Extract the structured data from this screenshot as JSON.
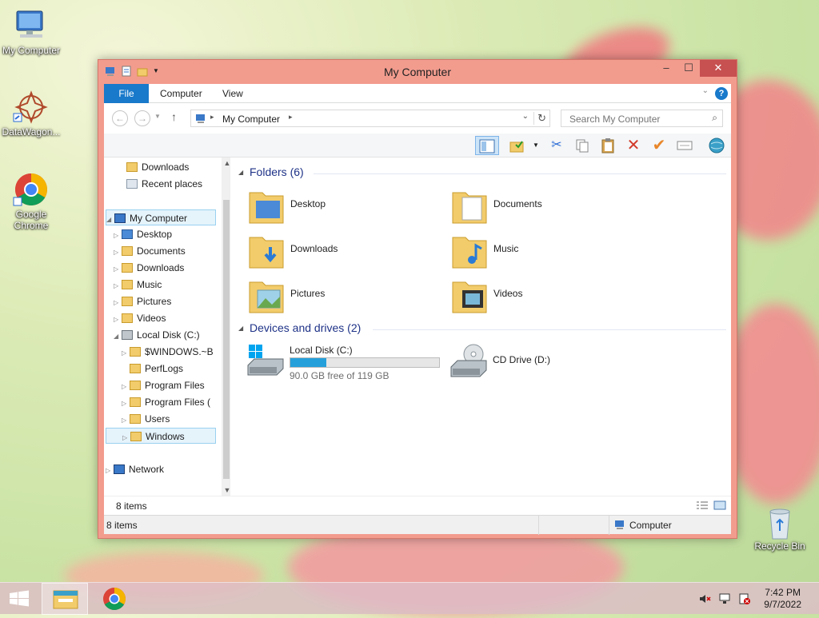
{
  "desktop": {
    "icons": [
      {
        "label": "My Computer"
      },
      {
        "label": "DataWagon..."
      },
      {
        "label": "Google Chrome"
      },
      {
        "label": "Recycle Bin"
      }
    ]
  },
  "window": {
    "title": "My Computer",
    "ribbon_tabs": [
      "File",
      "Computer",
      "View"
    ],
    "address": "My Computer",
    "search_placeholder": "Search My Computer",
    "nav_tree": {
      "top": [
        "Downloads",
        "Recent places"
      ],
      "my_computer": "My Computer",
      "children": [
        "Desktop",
        "Documents",
        "Downloads",
        "Music",
        "Pictures",
        "Videos"
      ],
      "local_disk": "Local Disk (C:)",
      "disk_children": [
        "$WINDOWS.~B",
        "PerfLogs",
        "Program Files",
        "Program Files (",
        "Users",
        "Windows"
      ],
      "network": "Network"
    },
    "content": {
      "folders_header": "Folders (6)",
      "folders": [
        "Desktop",
        "Documents",
        "Downloads",
        "Music",
        "Pictures",
        "Videos"
      ],
      "devices_header": "Devices and drives (2)",
      "drives": [
        {
          "name": "Local Disk (C:)",
          "free": "90.0 GB free of 119 GB",
          "used_fraction": 0.24
        },
        {
          "name": "CD Drive (D:)"
        }
      ]
    },
    "item_count": "8 items",
    "status_count": "8 items",
    "status_location": "Computer"
  },
  "taskbar": {
    "time": "7:42 PM",
    "date": "9/7/2022"
  },
  "colors": {
    "accent": "#1979ca",
    "window_frame": "#f29c8e",
    "close_button": "#c75050",
    "selection": "#e5f3fb",
    "drive_bar": "#26a0da",
    "folder": "#f2cc6b"
  }
}
